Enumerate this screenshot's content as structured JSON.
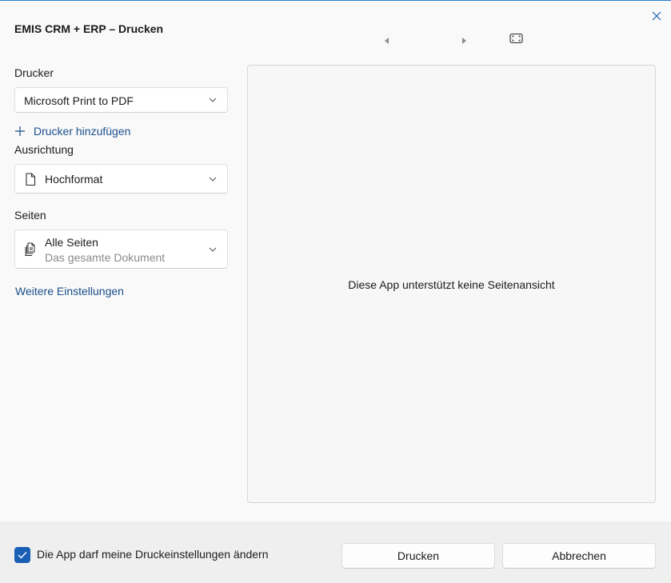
{
  "window": {
    "title": "EMIS CRM + ERP – Drucken",
    "accent_color": "#1a5fb4",
    "link_color": "#1a4f8c"
  },
  "toolbar": {
    "prev_icon": "triangle-left-icon",
    "next_icon": "triangle-right-icon",
    "fit_icon": "fit-to-window-icon",
    "close_icon": "close-icon"
  },
  "settings": {
    "printer": {
      "label": "Drucker",
      "value": "Microsoft Print to PDF"
    },
    "add_printer": {
      "label": "Drucker hinzufügen",
      "icon": "plus-icon"
    },
    "orientation": {
      "label": "Ausrichtung",
      "value": "Hochformat",
      "icon": "page-icon"
    },
    "pages": {
      "label": "Seiten",
      "value": "Alle Seiten",
      "subtext": "Das gesamte Dokument",
      "icon": "multi-page-icon"
    },
    "more_settings": "Weitere Einstellungen"
  },
  "preview": {
    "message": "Diese App unterstützt keine Seitenansicht"
  },
  "footer": {
    "allow_changes": {
      "label": "Die App darf meine Druckeinstellungen ändern",
      "checked": true
    },
    "print_button": "Drucken",
    "cancel_button": "Abbrechen"
  }
}
